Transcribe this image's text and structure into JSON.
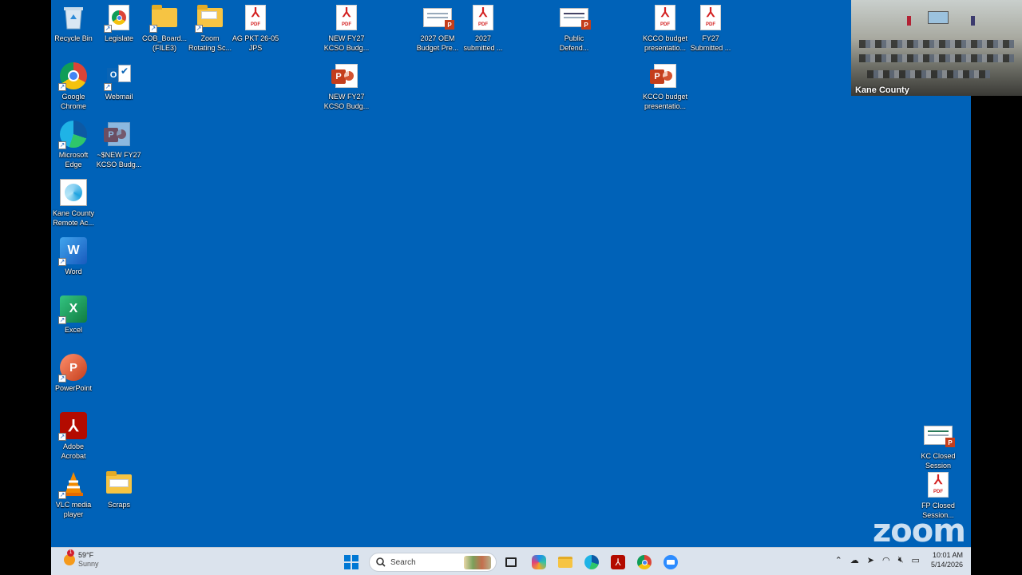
{
  "desktop": {
    "icons": [
      {
        "label": "Recycle Bin",
        "icon": "recycle-bin-icon"
      },
      {
        "label": "Legislate",
        "icon": "chrome-shortcut-icon"
      },
      {
        "label": "COB_Board...\n(FILE3)",
        "icon": "folder-icon"
      },
      {
        "label": "Zoom\nRotating Sc...",
        "icon": "folder-icon"
      },
      {
        "label": "AG PKT 26-05\nJPS",
        "icon": "pdf-icon"
      },
      {
        "label": "NEW FY27\nKCSO Budg...",
        "icon": "pdf-icon"
      },
      {
        "label": "2027 OEM\nBudget Pre...",
        "icon": "ppt-thumbnail-icon"
      },
      {
        "label": "2027\nsubmitted ...",
        "icon": "pdf-icon"
      },
      {
        "label": "Public\nDefend...",
        "icon": "ppt-thumbnail-icon"
      },
      {
        "label": "KCCO budget\npresentatio...",
        "icon": "pdf-icon"
      },
      {
        "label": "FY27\nSubmitted ...",
        "icon": "pdf-icon"
      },
      {
        "label": "Google\nChrome",
        "icon": "chrome-icon"
      },
      {
        "label": "Webmail",
        "icon": "outlook-icon"
      },
      {
        "label": "NEW FY27\nKCSO Budg...",
        "icon": "powerpoint-file-icon"
      },
      {
        "label": "KCCO budget\npresentatio...",
        "icon": "powerpoint-file-icon"
      },
      {
        "label": "Microsoft\nEdge",
        "icon": "edge-icon"
      },
      {
        "label": "~$NEW FY27\nKCSO Budg...",
        "icon": "powerpoint-temp-file-icon"
      },
      {
        "label": "Kane County\nRemote Ac...",
        "icon": "remote-access-icon"
      },
      {
        "label": "Word",
        "icon": "word-icon"
      },
      {
        "label": "Excel",
        "icon": "excel-icon"
      },
      {
        "label": "PowerPoint",
        "icon": "powerpoint-icon"
      },
      {
        "label": "Adobe\nAcrobat",
        "icon": "acrobat-icon"
      },
      {
        "label": "VLC media\nplayer",
        "icon": "vlc-icon"
      },
      {
        "label": "Scraps",
        "icon": "folder-icon"
      },
      {
        "label": "KC Closed\nSession",
        "icon": "ppt-thumbnail-icon"
      },
      {
        "label": "FP Closed\nSession...",
        "icon": "pdf-icon"
      }
    ]
  },
  "zoom": {
    "camera_caption": "Kane County",
    "logo": "zoom"
  },
  "taskbar": {
    "weather": {
      "temp": "59°F",
      "condition": "Sunny",
      "alert_count": "1"
    },
    "search_placeholder": "Search",
    "clock": {
      "time": "10:01 AM",
      "date": "5/14/2026"
    }
  },
  "colors": {
    "desktop_bg": "#0062b8",
    "taskbar_bg": "#dbe3ed",
    "pdf_red": "#d32020",
    "ppt_orange": "#c43e1c"
  }
}
